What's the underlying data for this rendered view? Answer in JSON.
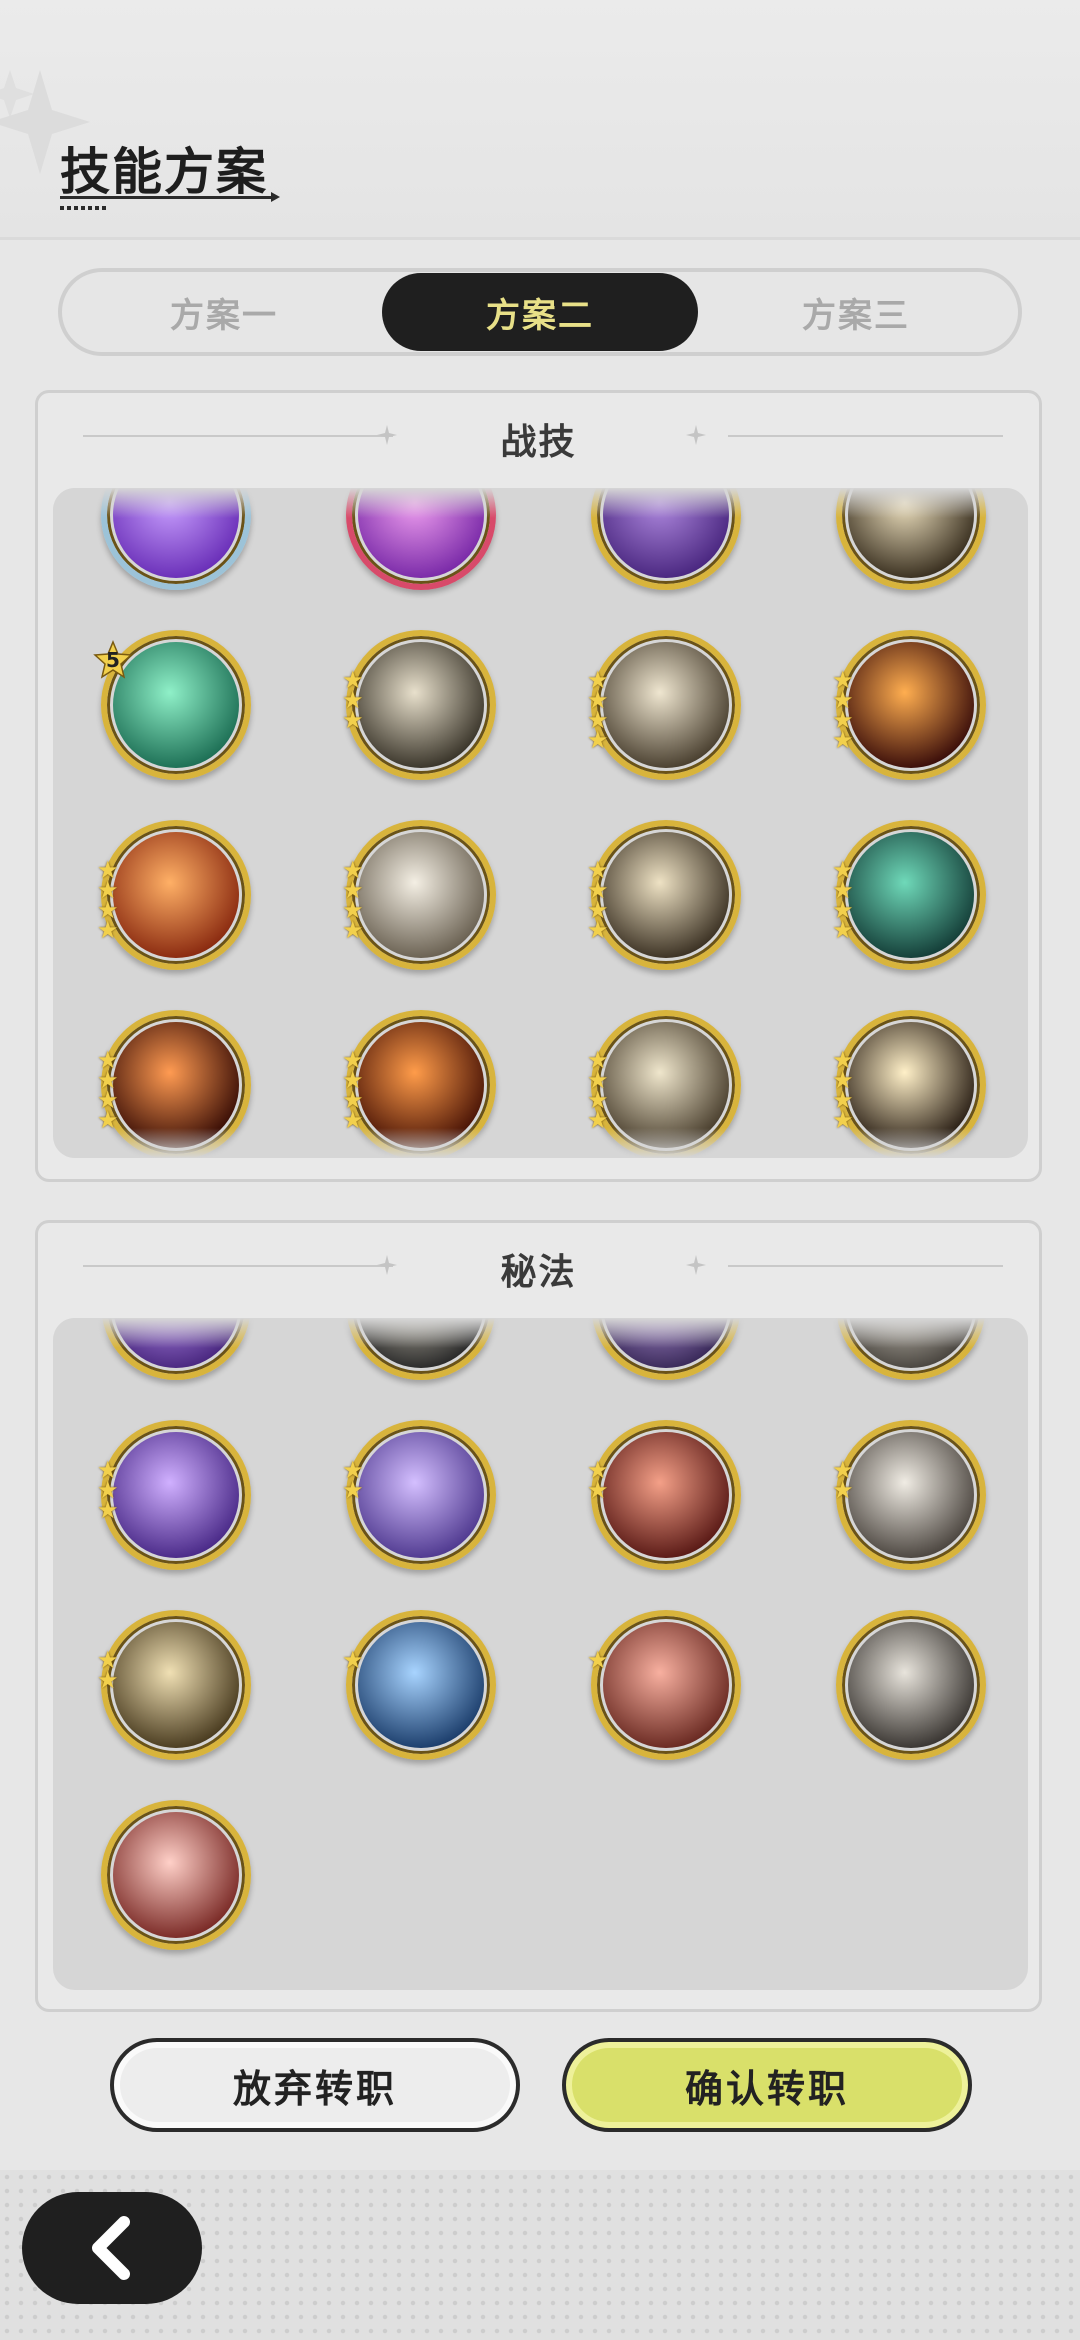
{
  "header": {
    "title": "技能方案"
  },
  "tabs": [
    {
      "label": "方案一",
      "active": false
    },
    {
      "label": "方案二",
      "active": true
    },
    {
      "label": "方案三",
      "active": false
    }
  ],
  "sections": {
    "combat": {
      "title": "战技"
    },
    "arcane": {
      "title": "秘法"
    }
  },
  "combat_skills": [
    {
      "icon": "violet-heart-burst-icon",
      "colors": [
        "#c9a0ff",
        "#6a2fb8"
      ],
      "ring": "#9cc3d8",
      "stars": 0
    },
    {
      "icon": "pink-vortex-icon",
      "colors": [
        "#f0a0f0",
        "#7a2aa8"
      ],
      "ring": "#d84a6a",
      "stars": 0
    },
    {
      "icon": "dark-claw-icon",
      "colors": [
        "#b08ae0",
        "#4a2780"
      ],
      "ring": "#d8b43c",
      "stars": 0
    },
    {
      "icon": "golden-figure-icon",
      "colors": [
        "#efe2c0",
        "#3a3020"
      ],
      "ring": "#d8b43c",
      "stars": 0
    },
    {
      "icon": "green-arrows-up-icon",
      "colors": [
        "#8ff0c8",
        "#1d6f55"
      ],
      "ring": "#d8b43c",
      "stars": 0,
      "badge": "5"
    },
    {
      "icon": "wind-slash-icon",
      "colors": [
        "#e8e0cc",
        "#3a352a"
      ],
      "ring": "#d8b43c",
      "stars": 3
    },
    {
      "icon": "whirlwind-icon",
      "colors": [
        "#efe6d0",
        "#4a4030"
      ],
      "ring": "#d8b43c",
      "stars": 4
    },
    {
      "icon": "fire-spiral-icon",
      "colors": [
        "#ffae50",
        "#3b0e0a"
      ],
      "ring": "#d8b43c",
      "stars": 4
    },
    {
      "icon": "flame-rune-icon",
      "colors": [
        "#ffb066",
        "#8a2a10"
      ],
      "ring": "#d8b43c",
      "stars": 4
    },
    {
      "icon": "afterimage-figures-icon",
      "colors": [
        "#f4efe4",
        "#6a6152"
      ],
      "ring": "#d8b43c",
      "stars": 4
    },
    {
      "icon": "sword-swing-icon",
      "colors": [
        "#eee2c4",
        "#3c3224"
      ],
      "ring": "#d8b43c",
      "stars": 4
    },
    {
      "icon": "spider-web-icon",
      "colors": [
        "#6fd9b9",
        "#143e38"
      ],
      "ring": "#d8b43c",
      "stars": 4
    },
    {
      "icon": "fire-arc-icon",
      "colors": [
        "#ff9b52",
        "#3a0e06"
      ],
      "ring": "#d8b43c",
      "stars": 4
    },
    {
      "icon": "blazing-fire-icon",
      "colors": [
        "#ff9c4a",
        "#4a1406"
      ],
      "ring": "#d8b43c",
      "stars": 4
    },
    {
      "icon": "shattered-blade-icon",
      "colors": [
        "#efe6cc",
        "#4a3f2e"
      ],
      "ring": "#d8b43c",
      "stars": 4
    },
    {
      "icon": "ground-burst-icon",
      "colors": [
        "#fff0c8",
        "#2b2016"
      ],
      "ring": "#d8b43c",
      "stars": 4
    }
  ],
  "arcane_skills": [
    {
      "icon": "purple-crescent-icon",
      "colors": [
        "#c8a0ff",
        "#4a2880"
      ],
      "stars": 0
    },
    {
      "icon": "dark-shield-icon",
      "colors": [
        "#d8d2c0",
        "#2a2a2a"
      ],
      "stars": 0
    },
    {
      "icon": "purple-beast-icon",
      "colors": [
        "#c8a8ee",
        "#3a2a5a"
      ],
      "stars": 0
    },
    {
      "icon": "grey-figure-icon",
      "colors": [
        "#e6e0d4",
        "#4a4640"
      ],
      "stars": 0
    },
    {
      "icon": "purple-aura-figure-icon",
      "colors": [
        "#d0b0ff",
        "#4a2a88"
      ],
      "stars": 3
    },
    {
      "icon": "arcane-orb-icon",
      "colors": [
        "#d4bfff",
        "#503a90"
      ],
      "stars": 2
    },
    {
      "icon": "crimson-strike-icon",
      "colors": [
        "#f4a088",
        "#5a1a16"
      ],
      "stars": 2
    },
    {
      "icon": "blade-pillar-icon",
      "colors": [
        "#f0ece4",
        "#4c4640"
      ],
      "stars": 2
    },
    {
      "icon": "golden-guardian-icon",
      "colors": [
        "#f0e0b4",
        "#4a3c20"
      ],
      "stars": 2
    },
    {
      "icon": "blue-crest-icon",
      "colors": [
        "#a8d4ff",
        "#1c3e6c"
      ],
      "stars": 1
    },
    {
      "icon": "red-blossom-icon",
      "colors": [
        "#f8b0a0",
        "#6a2a22"
      ],
      "stars": 1
    },
    {
      "icon": "shield-dancer-icon",
      "colors": [
        "#e8e4dc",
        "#3a3632"
      ],
      "stars": 0
    },
    {
      "icon": "crimson-swirl-icon",
      "colors": [
        "#ffd0c8",
        "#7a2a26"
      ],
      "stars": 0
    }
  ],
  "buttons": {
    "cancel": "放弃转职",
    "confirm": "确认转职"
  },
  "colors": {
    "accent": "#d9e06a",
    "tab_active_text": "#e8e088",
    "ring_gold": "#d8b43c"
  }
}
